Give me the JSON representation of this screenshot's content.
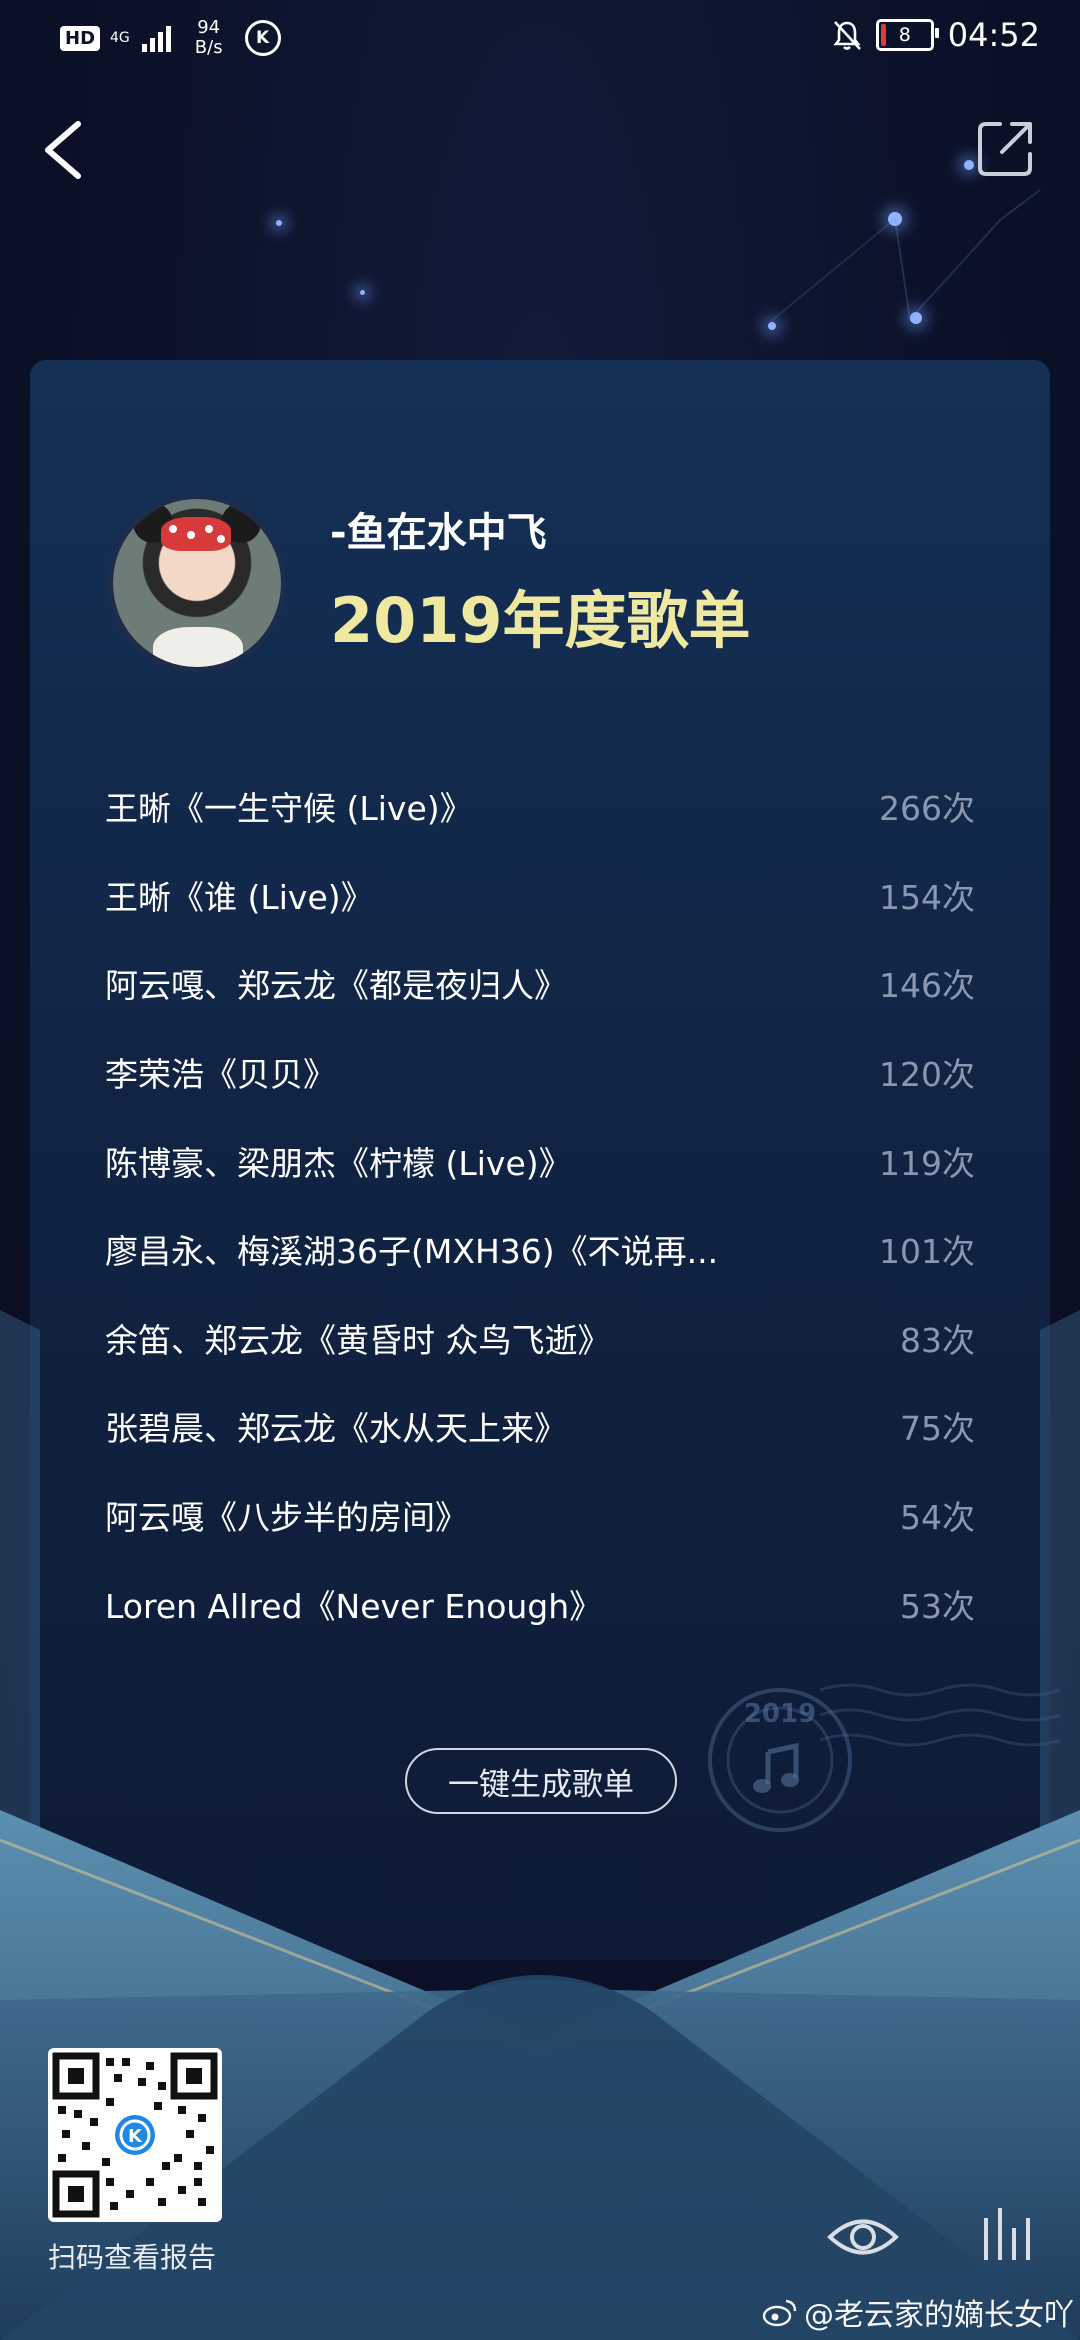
{
  "status_bar": {
    "hd": "HD",
    "network": "4G",
    "net_speed_value": "94",
    "net_speed_unit": "B/s",
    "app_badge": "K",
    "battery_level": "8",
    "time": "04:52"
  },
  "header": {
    "back_icon": "chevron-left-icon",
    "share_icon": "share-icon"
  },
  "report": {
    "username": "-鱼在水中飞",
    "title": "2019年度歌单",
    "songs": [
      {
        "title": "王晰《一生守候 (Live)》",
        "count": "266次"
      },
      {
        "title": "王晰《谁 (Live)》",
        "count": "154次"
      },
      {
        "title": "阿云嘎、郑云龙《都是夜归人》",
        "count": "146次"
      },
      {
        "title": "李荣浩《贝贝》",
        "count": "120次"
      },
      {
        "title": "陈博豪、梁朋杰《柠檬 (Live)》",
        "count": "119次"
      },
      {
        "title": "廖昌永、梅溪湖36子(MXH36)《不说再...",
        "count": "101次"
      },
      {
        "title": "余笛、郑云龙《黄昏时 众鸟飞逝》",
        "count": "83次"
      },
      {
        "title": "张碧晨、郑云龙《水从天上来》",
        "count": "75次"
      },
      {
        "title": "阿云嘎《八步半的房间》",
        "count": "54次"
      },
      {
        "title": "Loren Allred《Never Enough》",
        "count": "53次"
      }
    ],
    "generate_button": "一键生成歌单",
    "stamp_year": "2019"
  },
  "footer": {
    "qr_badge": "K",
    "qr_caption": "扫码查看报告",
    "watermark": "@老云家的嫡长女吖"
  },
  "colors": {
    "background": "#0b1128",
    "card": "#112444",
    "title_accent": "#eee8a0",
    "count_text": "#8a97ae",
    "envelope": "#4f7c9c"
  }
}
